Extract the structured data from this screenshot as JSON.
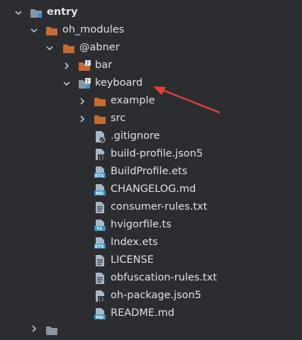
{
  "colors": {
    "background": "#2b2d30",
    "text": "#dfe1e5",
    "folder": "#c56b32",
    "module": "#6a8eae",
    "arrow": "#e5403a",
    "file_gray": "#a9b7c6",
    "badge_ets": "#3592c4",
    "badge_md": "#3592c4",
    "badge_ts": "#3592c4"
  },
  "tree": {
    "entry": "entry",
    "oh_modules": "oh_modules",
    "abner": "@abner",
    "bar": "bar",
    "keyboard": "keyboard",
    "example": "example",
    "src": "src",
    "files": [
      {
        "name": ".gitignore",
        "icon": "gitignore-file-icon"
      },
      {
        "name": "build-profile.json5",
        "icon": "json-file-icon"
      },
      {
        "name": "BuildProfile.ets",
        "icon": "ets-file-icon"
      },
      {
        "name": "CHANGELOG.md",
        "icon": "md-file-icon"
      },
      {
        "name": "consumer-rules.txt",
        "icon": "text-file-icon"
      },
      {
        "name": "hvigorfile.ts",
        "icon": "ts-file-icon"
      },
      {
        "name": "Index.ets",
        "icon": "ets-file-icon"
      },
      {
        "name": "LICENSE",
        "icon": "text-file-icon"
      },
      {
        "name": "obfuscation-rules.txt",
        "icon": "text-file-icon"
      },
      {
        "name": "oh-package.json5",
        "icon": "json-file-icon"
      },
      {
        "name": "README.md",
        "icon": "md-file-icon"
      }
    ],
    "badges": {
      "ets": "ETS",
      "md": "MD",
      "ts": "TS",
      "json": "{}"
    }
  }
}
